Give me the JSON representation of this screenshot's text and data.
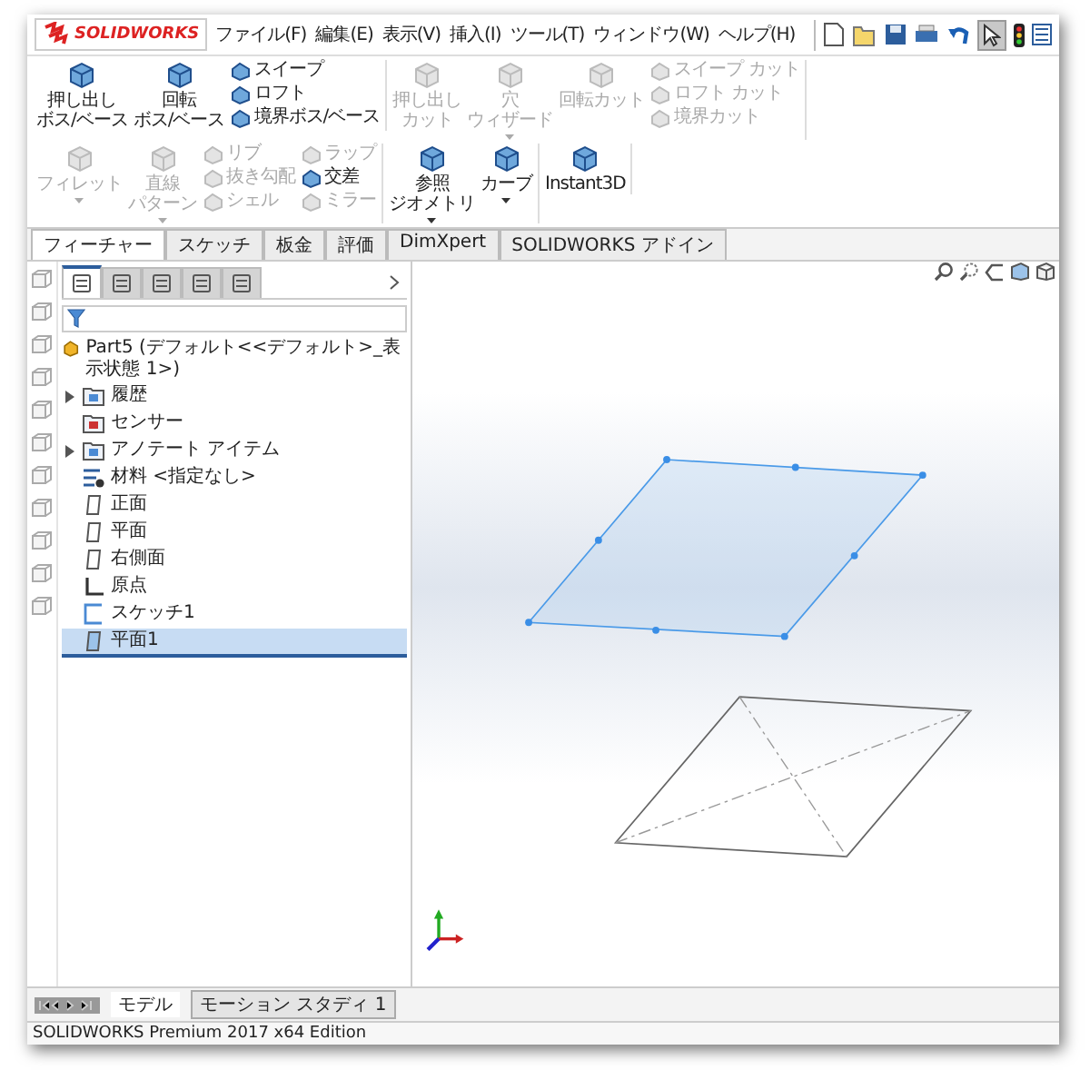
{
  "app": {
    "logo": "SOLIDWORKS"
  },
  "menu": [
    "ファイル(F)",
    "編集(E)",
    "表示(V)",
    "挿入(I)",
    "ツール(T)",
    "ウィンドウ(W)",
    "ヘルプ(H)"
  ],
  "quick_toolbar": {
    "select_tool_pressed": true
  },
  "ribbon": [
    {
      "items": [
        {
          "kind": "large",
          "label": [
            "押し出し",
            "ボス/ベース"
          ],
          "disabled": false,
          "dropdown": false
        },
        {
          "kind": "large",
          "label": [
            "回転",
            "ボス/ベース"
          ],
          "disabled": false,
          "dropdown": false
        },
        {
          "kind": "stack",
          "rows": [
            {
              "label": "スイープ",
              "disabled": false
            },
            {
              "label": "ロフト",
              "disabled": false
            },
            {
              "label": "境界ボス/ベース",
              "disabled": false
            }
          ]
        }
      ]
    },
    {
      "items": [
        {
          "kind": "large",
          "label": [
            "押し出し",
            "カット"
          ],
          "disabled": true,
          "dropdown": false
        },
        {
          "kind": "large",
          "label": [
            "穴",
            "ウィザード"
          ],
          "disabled": true,
          "dropdown": true
        },
        {
          "kind": "large",
          "label": [
            "回転カット"
          ],
          "disabled": true,
          "dropdown": false
        },
        {
          "kind": "stack",
          "rows": [
            {
              "label": "スイープ カット",
              "disabled": true
            },
            {
              "label": "ロフト カット",
              "disabled": true
            },
            {
              "label": "境界カット",
              "disabled": true
            }
          ]
        }
      ]
    },
    {
      "items": [
        {
          "kind": "large",
          "label": [
            "フィレット"
          ],
          "disabled": true,
          "dropdown": true
        },
        {
          "kind": "large",
          "label": [
            "直線",
            "パターン"
          ],
          "disabled": true,
          "dropdown": true
        },
        {
          "kind": "stack",
          "rows": [
            {
              "label": "リブ",
              "disabled": true
            },
            {
              "label": "抜き勾配",
              "disabled": true
            },
            {
              "label": "シェル",
              "disabled": true
            }
          ]
        },
        {
          "kind": "stack",
          "rows": [
            {
              "label": "ラップ",
              "disabled": true
            },
            {
              "label": "交差",
              "disabled": false
            },
            {
              "label": "ミラー",
              "disabled": true
            }
          ]
        }
      ]
    },
    {
      "items": [
        {
          "kind": "large",
          "label": [
            "参照",
            "ジオメトリ"
          ],
          "disabled": false,
          "dropdown": true
        },
        {
          "kind": "large",
          "label": [
            "カーブ"
          ],
          "disabled": false,
          "dropdown": true
        }
      ]
    },
    {
      "items": [
        {
          "kind": "large",
          "label": [
            "Instant3D"
          ],
          "disabled": false,
          "dropdown": false
        }
      ]
    }
  ],
  "tabs": [
    {
      "label": "フィーチャー",
      "selected": true
    },
    {
      "label": "スケッチ",
      "selected": false
    },
    {
      "label": "板金",
      "selected": false
    },
    {
      "label": "評価",
      "selected": false
    },
    {
      "label": "DimXpert",
      "selected": false
    },
    {
      "label": "SOLIDWORKS アドイン",
      "selected": false
    }
  ],
  "panel_tabs": [
    {
      "selected": true
    },
    {
      "selected": false
    },
    {
      "selected": false
    },
    {
      "selected": false
    },
    {
      "selected": false
    }
  ],
  "tree": {
    "root": "Part5 (デフォルト<<デフォルト>_表示状態 1>)",
    "items": [
      {
        "kind": "folder",
        "label": "履歴",
        "arrow": true,
        "selected": false
      },
      {
        "kind": "sensor",
        "label": "センサー",
        "arrow": false,
        "selected": false
      },
      {
        "kind": "annotation",
        "label": "アノテート アイテム",
        "arrow": true,
        "selected": false
      },
      {
        "kind": "material",
        "label": "材料 <指定なし>",
        "arrow": false,
        "selected": false
      },
      {
        "kind": "plane",
        "label": "正面",
        "arrow": false,
        "selected": false
      },
      {
        "kind": "plane",
        "label": "平面",
        "arrow": false,
        "selected": false
      },
      {
        "kind": "plane",
        "label": "右側面",
        "arrow": false,
        "selected": false
      },
      {
        "kind": "origin",
        "label": "原点",
        "arrow": false,
        "selected": false
      },
      {
        "kind": "sketch",
        "label": "スケッチ1",
        "arrow": false,
        "selected": false
      },
      {
        "kind": "plane",
        "label": "平面1",
        "arrow": false,
        "selected": true
      }
    ]
  },
  "viewport": {
    "plane_selected": true
  },
  "bottom_tabs": [
    {
      "label": "モデル",
      "selected": true
    },
    {
      "label": "モーション スタディ 1",
      "selected": false
    }
  ],
  "status_bar": "SOLIDWORKS Premium 2017 x64 Edition"
}
